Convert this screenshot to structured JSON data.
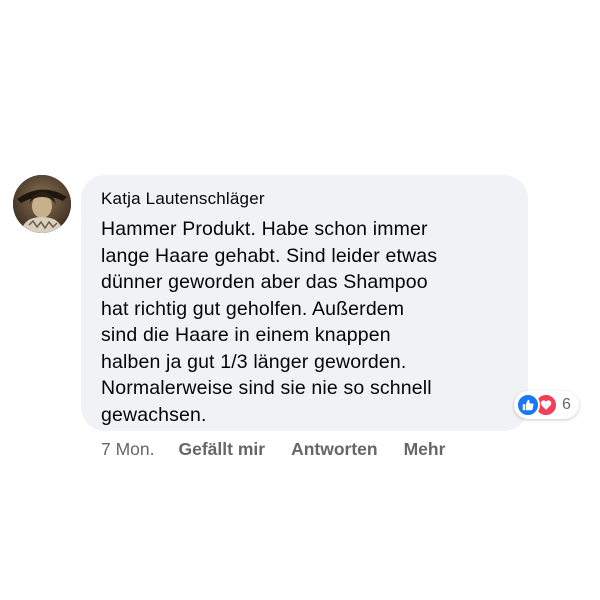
{
  "comment": {
    "author": "Katja Lautenschläger",
    "text": "Hammer Produkt. Habe schon immer\nlange Haare gehabt. Sind leider etwas\ndünner geworden aber das Shampoo\nhat richtig gut geholfen. Außerdem\nsind die Haare in einem knappen\nhalben ja gut 1/3 länger geworden.\nNormalerweise sind sie nie so schnell\ngewachsen.",
    "reactions": {
      "types": [
        "like-icon",
        "love-icon"
      ],
      "count": "6",
      "like_color": "#1877f2",
      "love_color": "#f33e58"
    },
    "timestamp": "7 Mon.",
    "actions": {
      "like_label": "Gefällt mir",
      "reply_label": "Antworten",
      "more_label": "Mehr"
    }
  },
  "colors": {
    "bubble_bg": "#f0f2f5",
    "meta_text": "#65676b",
    "body_text": "#050505"
  }
}
